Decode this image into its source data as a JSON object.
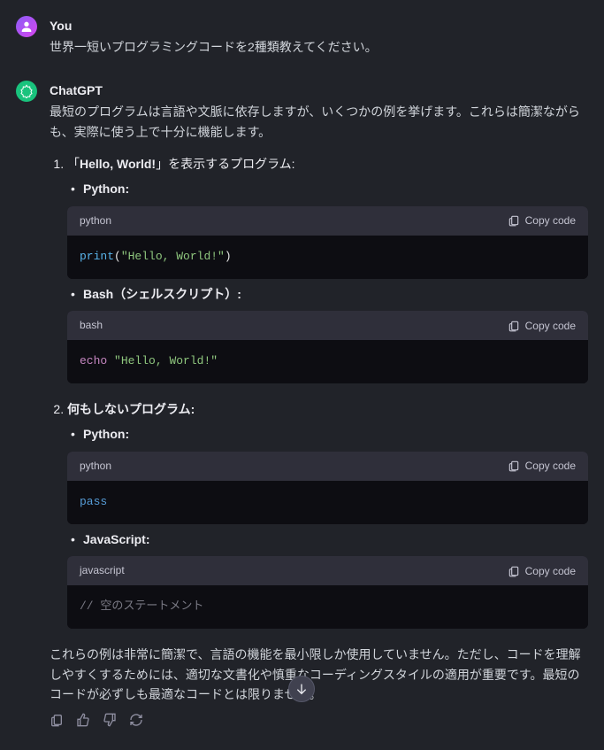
{
  "user": {
    "author": "You",
    "text": "世界一短いプログラミングコードを2種類教えてください。"
  },
  "assistant": {
    "author": "ChatGPT",
    "intro": "最短のプログラムは言語や文脈に依存しますが、いくつかの例を挙げます。これらは簡潔ながらも、実際に使う上で十分に機能します。",
    "items": [
      {
        "title_pre": "「",
        "title_bold": "Hello, World!",
        "title_post": "」を表示するプログラム:",
        "subs": [
          {
            "lang_label": "Python:",
            "code_lang": "python",
            "code": {
              "fn": "print",
              "open": "(",
              "str": "\"Hello, World!\"",
              "close": ")"
            }
          },
          {
            "lang_label": "Bash（シェルスクリプト）:",
            "code_lang": "bash",
            "code": {
              "kw": "echo",
              "sp": " ",
              "str": "\"Hello, World!\""
            }
          }
        ]
      },
      {
        "title_pre": "",
        "title_bold": "何もしないプログラム:",
        "title_post": "",
        "subs": [
          {
            "lang_label": "Python:",
            "code_lang": "python",
            "code": {
              "kw2": "pass"
            }
          },
          {
            "lang_label": "JavaScript:",
            "code_lang": "javascript",
            "code": {
              "cmt": "// 空のステートメント"
            }
          }
        ]
      }
    ],
    "closing": "これらの例は非常に簡潔で、言語の機能を最小限しか使用していません。ただし、コードを理解しやすくするためには、適切な文書化や慎重なコーディングスタイルの適用が重要です。最短のコードが必ずしも最適なコードとは限りません。"
  },
  "ui": {
    "copy_label": "Copy code"
  }
}
